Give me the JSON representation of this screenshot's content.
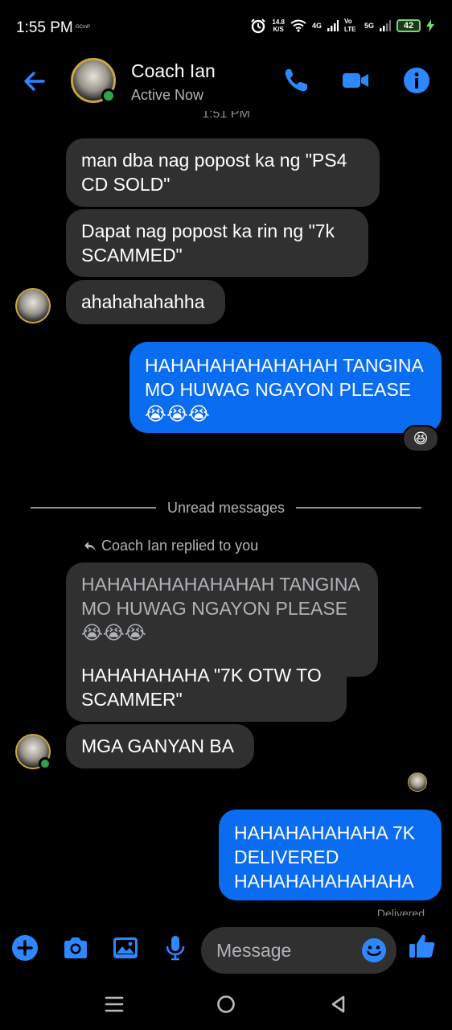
{
  "status_bar": {
    "time": "1:55 PM",
    "carrier_small": "GCmP",
    "speed_value": "14.8",
    "speed_unit": "K/S",
    "net_4g": "4G",
    "volte": "Vo LTE",
    "net_5g": "5G",
    "battery": "42"
  },
  "header": {
    "contact_name": "Coach Ian",
    "status": "Active Now",
    "partial_time": "1:51 PM"
  },
  "messages": {
    "m1": "man dba nag popost ka ng \"PS4 CD SOLD\"",
    "m2": "Dapat nag popost ka rin ng \"7k SCAMMED\"",
    "m3": "ahahahahahha",
    "m4": "HAHAHAHAHAHAHAH TANGINA MO HUWAG NGAYON PLEASE 😭😭😭",
    "m4_reaction": "😆",
    "divider": "Unread messages",
    "replied_note": "Coach Ian replied to you",
    "m5_quoted": "HAHAHAHAHAHAHAH TANGINA MO HUWAG NGAYON PLEASE 😭😭😭",
    "m5_reply": "HAHAHAHAHA \"7K OTW TO SCAMMER\"",
    "m6": "MGA GANYAN BA",
    "m7": "HAHAHAHAHAHA 7K DELIVERED HAHAHAHAHAHAHA",
    "delivered": "Delivered"
  },
  "composer": {
    "placeholder": "Message"
  },
  "colors": {
    "accent": "#0a6cf0",
    "incoming_bubble": "#303030",
    "online": "#31a24c"
  },
  "icons": [
    "back-arrow-icon",
    "phone-icon",
    "video-icon",
    "info-icon",
    "plus-icon",
    "camera-icon",
    "gallery-icon",
    "microphone-icon",
    "emoji-icon",
    "thumbs-up-icon",
    "reply-arrow-icon",
    "menu-icon",
    "home-icon",
    "back-triangle-icon"
  ]
}
